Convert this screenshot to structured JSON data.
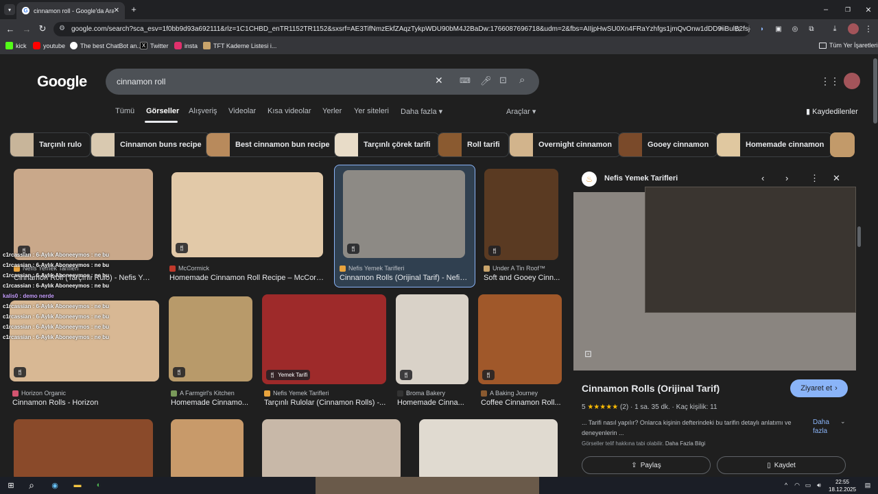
{
  "browser": {
    "tab_title": "cinnamon roll - Google'da Ara",
    "url": "google.com/search?sca_esv=1f0bb9d93a692111&rlz=1C1CHBD_enTR1152TR1152&sxsrf=AE3TifNmzEkfZAqzTykpWDU90bM4J2BaDw:1766087696718&udm=2&fbs=AIIjpHwSU0Xn4FRaYzhfgs1jmQvOnw1dDD9iiBulB2fsjeHv6X...",
    "bookmarks": [
      {
        "label": "kick",
        "color": "#53fc18"
      },
      {
        "label": "youtube",
        "color": "#ff0000"
      },
      {
        "label": "The best ChatBot an...",
        "color": "#ffffff"
      },
      {
        "label": "Twitter",
        "color": "#000000"
      },
      {
        "label": "insta",
        "color": "#e1306c"
      },
      {
        "label": "TFT Kademe Listesi i...",
        "color": "#c9a46b"
      }
    ],
    "all_bookmarks": "Tüm Yer İşaretleri"
  },
  "google": {
    "logo": "Google",
    "query": "cinnamon roll",
    "nav": [
      "Tümü",
      "Görseller",
      "Alışveriş",
      "Videolar",
      "Kısa videolar",
      "Yerler",
      "Yer siteleri",
      "Daha fazla"
    ],
    "tools": "Araçlar",
    "saved": "Kaydedilenler"
  },
  "chips": [
    {
      "label": "Tarçınlı rulo",
      "color": "#c8b59a"
    },
    {
      "label": "Cinnamon buns recipe",
      "color": "#d9c9b0"
    },
    {
      "label": "Best cinnamon bun recipe",
      "color": "#b88a5c"
    },
    {
      "label": "Tarçınlı çörek tarifi",
      "color": "#e8dcc8"
    },
    {
      "label": "Roll tarifi",
      "color": "#8a5a30"
    },
    {
      "label": "Overnight cinnamon",
      "color": "#d2b48c"
    },
    {
      "label": "Gooey cinnamon",
      "color": "#7a4a2a"
    },
    {
      "label": "Homemade cinnamon",
      "color": "#e0c8a0"
    }
  ],
  "results": [
    {
      "source": "Nefis Yemek Tarifleri",
      "title": "Cinnamon Roll (Tarçınlı Rulo) - Nefis Yem...",
      "bg": "#c9a88a",
      "fav": "#e8a33d"
    },
    {
      "source": "McCormick",
      "title": "Homemade Cinnamon Roll Recipe – McCormick",
      "bg": "#e2c9a8",
      "fav": "#c0392b"
    },
    {
      "source": "Nefis Yemek Tarifleri",
      "title": "Cinnamon Rolls (Orijinal Tarif) - Nefis ...",
      "bg": "#8d8a85",
      "fav": "#e8a33d"
    },
    {
      "source": "Under A Tin Roof™",
      "title": "Soft and Gooey Cinn...",
      "bg": "#5a3a22",
      "fav": "#c9a46b"
    },
    {
      "source": "Horizon Organic",
      "title": "Cinnamon Rolls - Horizon",
      "bg": "#d8b894",
      "fav": "#d35470"
    },
    {
      "source": "A Farmgirl's Kitchen",
      "title": "Homemade Cinnamo...",
      "bg": "#b89a6a",
      "fav": "#7a9a5a"
    },
    {
      "source": "Nefis Yemek Tarifleri",
      "title": "Tarçınlı Rulolar (Cinnamon Rolls) -...",
      "bg": "#9e2a2a",
      "fav": "#e8a33d",
      "badge": "Yemek Tarifi"
    },
    {
      "source": "Broma Bakery",
      "title": "Homemade Cinna...",
      "bg": "#d9d2c8",
      "fav": "#333333"
    },
    {
      "source": "A Baking Journey",
      "title": "Coffee Cinnamon Roll...",
      "bg": "#a0582a",
      "fav": "#8a5a30"
    }
  ],
  "panel": {
    "source": "Nefis Yemek Tarifleri",
    "title": "Cinnamon Rolls (Orijinal Tarif)",
    "visit": "Ziyaret et",
    "rating": "5",
    "stars": "★★★★★",
    "reviews": "(2)",
    "time": "1 sa. 35 dk.",
    "servings": "Kaç kişilik: 11",
    "desc": "... Tarifi nasıl yapılır? Onlarca kişinin defterindeki bu tarifin detaylı anlatımı ve deneyenlerin ...",
    "more": "Daha fazla",
    "copyright": "Görseller telif hakkına tabi olabilir.",
    "more_info": "Daha Fazla Bilgi",
    "share": "Paylaş",
    "save": "Kaydet"
  },
  "chat": [
    "c1rcassian : 6-Aylık Aboneeymos : ne bu",
    "c1rcassian : 6-Aylık Aboneeymos : ne bu",
    "c1rcassian : 6-Aylık Aboneeymos : ne bu",
    "c1rcassian : 6-Aylık Aboneeymos : ne bu",
    "kalis0 : demo nerde",
    "c1rcassian : 6-Aylık Aboneeymos : ne bu",
    "c1rcassian : 6-Aylık Aboneeymos : ne bu",
    "c1rcassian : 6-Aylık Aboneeymos : ne bu",
    "c1rcassian : 6-Aylık Aboneeymos : ne bu"
  ],
  "taskbar": {
    "time": "22:55",
    "date": "18.12.2025"
  }
}
